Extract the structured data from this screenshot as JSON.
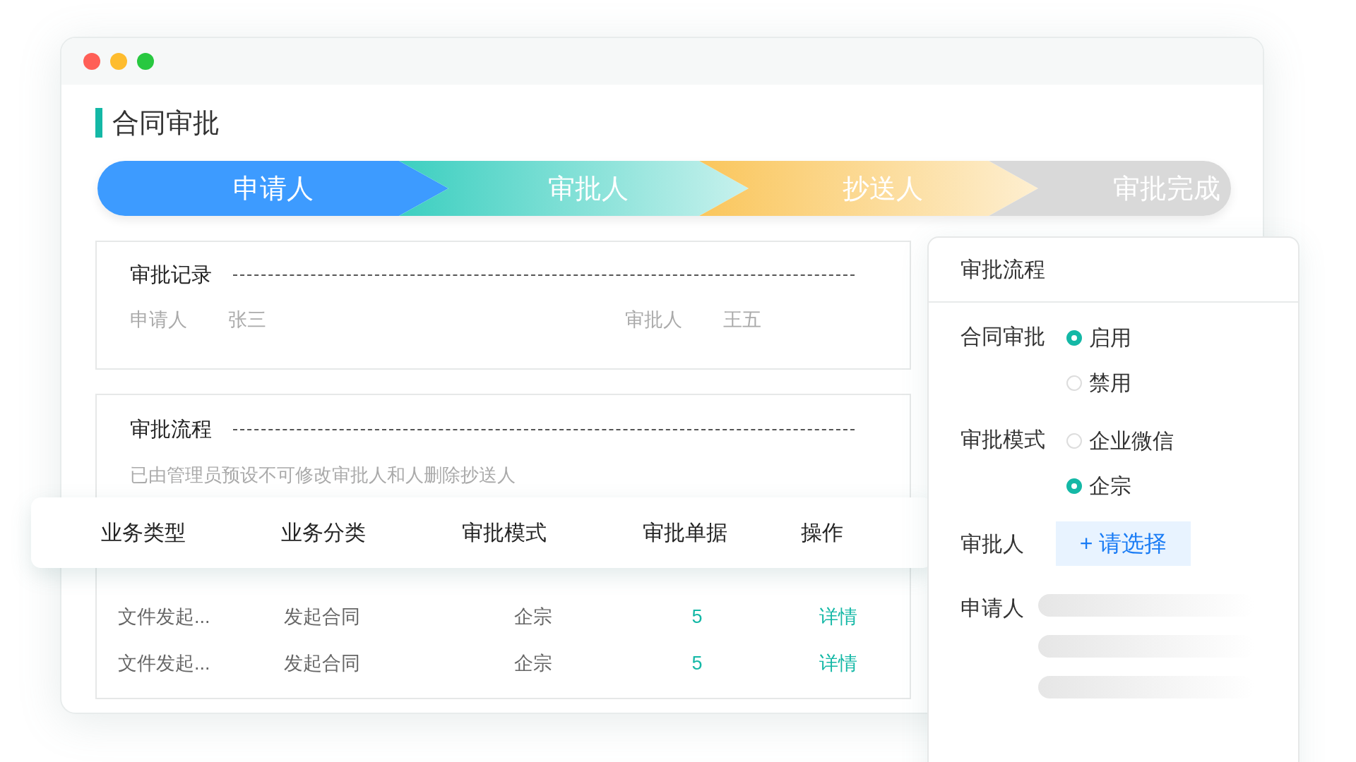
{
  "window": {
    "title": "合同审批"
  },
  "steps": [
    {
      "label": "申请人",
      "color": "#3d9bff",
      "fade": false
    },
    {
      "label": "审批人",
      "color": "#3ccfc0",
      "fade": true
    },
    {
      "label": "抄送人",
      "color": "#fac65c",
      "fade": true
    },
    {
      "label": "审批完成",
      "color": "#d9d9d9",
      "fade": false
    }
  ],
  "record": {
    "title": "审批记录",
    "fields": [
      {
        "label": "申请人",
        "value": "张三"
      },
      {
        "label": "审批人",
        "value": "王五"
      }
    ]
  },
  "flow": {
    "title": "审批流程",
    "note": "已由管理员预设不可修改审批人和人删除抄送人",
    "table": {
      "columns": [
        "业务类型",
        "业务分类",
        "审批模式",
        "审批单据",
        "操作"
      ],
      "rows": [
        [
          "文件发起...",
          "发起合同",
          "企宗",
          "5",
          "详情"
        ],
        [
          "文件发起...",
          "发起合同",
          "企宗",
          "5",
          "详情"
        ]
      ]
    }
  },
  "panel": {
    "title": "审批流程",
    "rows": [
      {
        "kind": "radio",
        "label": "合同审批",
        "options": [
          {
            "label": "启用",
            "selected": true
          },
          {
            "label": "禁用",
            "selected": false
          }
        ]
      },
      {
        "kind": "radio",
        "label": "审批模式",
        "options": [
          {
            "label": "企业微信",
            "selected": false
          },
          {
            "label": "企宗",
            "selected": true
          }
        ]
      },
      {
        "kind": "picker",
        "label": "审批人",
        "button": "+ 请选择"
      },
      {
        "kind": "skeleton",
        "label": "申请人"
      }
    ]
  }
}
